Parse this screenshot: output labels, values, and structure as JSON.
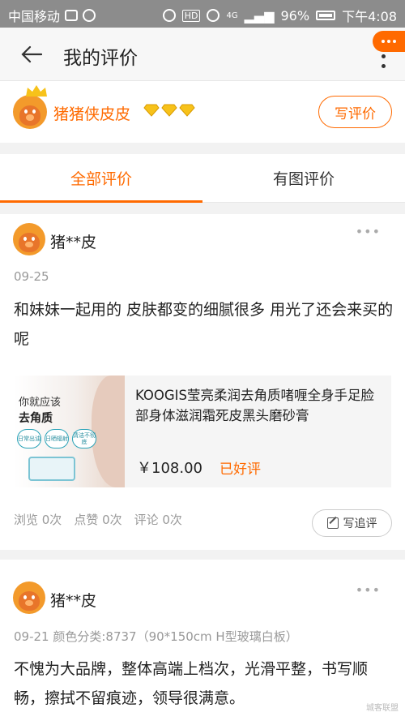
{
  "status_bar": {
    "carrier": "中国移动",
    "signal_label": "4G",
    "battery": "96%",
    "time": "下午4:08"
  },
  "header": {
    "title": "我的评价"
  },
  "profile": {
    "username": "猪猪侠皮皮",
    "write_review_label": "写评价"
  },
  "tabs": [
    {
      "label": "全部评价",
      "active": true
    },
    {
      "label": "有图评价",
      "active": false
    }
  ],
  "reviews": [
    {
      "username": "猪**皮",
      "meta": "09-25",
      "content": "和妹妹一起用的 皮肤都变的细腻很多 用光了还会来买的呢",
      "product": {
        "image_text1": "你就应该",
        "image_text2": "去角质",
        "image_tags": [
          "日常出油",
          "日晒辐射",
          "清洁不彻底"
        ],
        "title": "KOOGIS莹亮柔润去角质啫喱全身手足脸部身体滋润霜死皮黑头磨砂膏",
        "price": "￥108.00",
        "status": "已好评"
      },
      "stats": {
        "views": "浏览 0次",
        "likes": "点赞 0次",
        "comments": "评论 0次"
      },
      "add_review_label": "写追评"
    },
    {
      "username": "猪**皮",
      "meta": "09-21  颜色分类:8737（90*150cm H型玻璃白板）",
      "content": "不愧为大品牌，整体高端上档次，光滑平整，书写顺畅，擦拭不留痕迹，领导很满意。"
    }
  ],
  "watermark": "城客联盟"
}
